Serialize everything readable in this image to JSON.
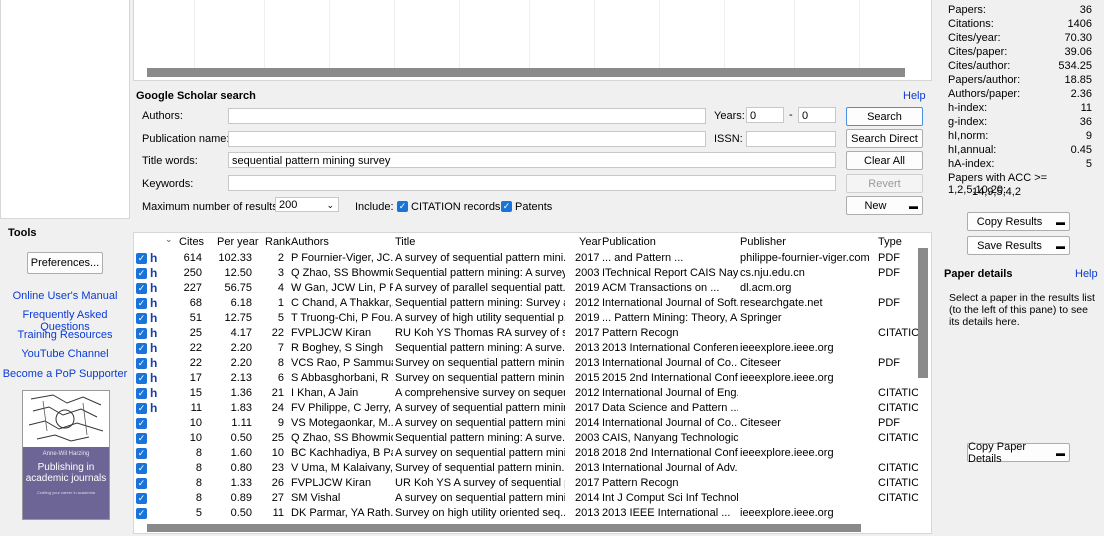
{
  "tools": {
    "title": "Tools",
    "preferences": "Preferences...",
    "links": [
      "Online User's Manual",
      "Frequently Asked Questions",
      "Training Resources",
      "YouTube Channel",
      "Become a PoP Supporter"
    ],
    "book": {
      "author": "Anne-Wil Harzing",
      "title": "Publishing in academic journals",
      "subtitle": "Crafting your career in academia"
    }
  },
  "search": {
    "title": "Google Scholar search",
    "help": "Help",
    "authors_label": "Authors:",
    "authors_value": "",
    "publication_label": "Publication name:",
    "publication_value": "",
    "title_words_label": "Title words:",
    "title_words_value": "sequential pattern mining survey",
    "keywords_label": "Keywords:",
    "keywords_value": "",
    "years_label": "Years:",
    "year_from": "0",
    "year_sep": "-",
    "year_to": "0",
    "issn_label": "ISSN:",
    "issn_value": "",
    "max_label": "Maximum number of results:",
    "max_value": "200",
    "include_label": "Include:",
    "citation_records": "CITATION records",
    "patents": "Patents",
    "buttons": {
      "search": "Search",
      "search_direct": "Search Direct",
      "clear_all": "Clear All",
      "revert": "Revert",
      "new": "New"
    }
  },
  "results": {
    "headers": [
      "Cites",
      "Per year",
      "Rank",
      "Authors",
      "Title",
      "Year",
      "Publication",
      "Publisher",
      "Type"
    ],
    "rows": [
      {
        "h": true,
        "cites": "614",
        "per_year": "102.33",
        "rank": "2",
        "authors": "P Fournier-Viger, JC...",
        "title": "A survey of sequential pattern mini...",
        "year": "2017",
        "publication": "... and Pattern ...",
        "publisher": "philippe-fournier-viger.com",
        "type": "PDF"
      },
      {
        "h": true,
        "cites": "250",
        "per_year": "12.50",
        "rank": "3",
        "authors": "Q Zhao, SS Bhowmick",
        "title": "Sequential pattern mining: A survey",
        "year": "2003",
        "publication": "ITechnical Report CAIS Nay...",
        "publisher": "cs.nju.edu.cn",
        "type": "PDF"
      },
      {
        "h": true,
        "cites": "227",
        "per_year": "56.75",
        "rank": "4",
        "authors": "W Gan, JCW Lin, P F...",
        "title": "A survey of parallel sequential patt...",
        "year": "2019",
        "publication": "ACM Transactions on ...",
        "publisher": "dl.acm.org",
        "type": ""
      },
      {
        "h": true,
        "cites": "68",
        "per_year": "6.18",
        "rank": "1",
        "authors": "C Chand, A Thakkar,...",
        "title": "Sequential pattern mining: Survey a...",
        "year": "2012",
        "publication": "International Journal of Soft...",
        "publisher": "researchgate.net",
        "type": "PDF"
      },
      {
        "h": true,
        "cites": "51",
        "per_year": "12.75",
        "rank": "5",
        "authors": "T Truong-Chi, P Fou...",
        "title": "A survey of high utility sequential p...",
        "year": "2019",
        "publication": "... Pattern Mining: Theory, A...",
        "publisher": "Springer",
        "type": ""
      },
      {
        "h": true,
        "cites": "25",
        "per_year": "4.17",
        "rank": "22",
        "authors": "FVPLJCW Kiran",
        "title": "RU Koh YS Thomas RA survey of se...",
        "year": "2017",
        "publication": "Pattern Recogn",
        "publisher": "",
        "type": "CITATION"
      },
      {
        "h": true,
        "cites": "22",
        "per_year": "2.20",
        "rank": "7",
        "authors": "R Boghey, S Singh",
        "title": "Sequential pattern mining: A surve...",
        "year": "2013",
        "publication": "2013 International Conferen...",
        "publisher": "ieeexplore.ieee.org",
        "type": ""
      },
      {
        "h": true,
        "cites": "22",
        "per_year": "2.20",
        "rank": "8",
        "authors": "VCS Rao, P Sammual",
        "title": "Survey on sequential pattern minin...",
        "year": "2013",
        "publication": "International Journal of Co...",
        "publisher": "Citeseer",
        "type": "PDF"
      },
      {
        "h": true,
        "cites": "17",
        "per_year": "2.13",
        "rank": "6",
        "authors": "S Abbasghorbani, R ...",
        "title": "Survey on sequential pattern minin...",
        "year": "2015",
        "publication": "2015 2nd International Conf...",
        "publisher": "ieeexplore.ieee.org",
        "type": ""
      },
      {
        "h": true,
        "cites": "15",
        "per_year": "1.36",
        "rank": "21",
        "authors": "I Khan, A Jain",
        "title": "A comprehensive survey on sequen...",
        "year": "2012",
        "publication": "International Journal of Eng...",
        "publisher": "",
        "type": "CITATION"
      },
      {
        "h": true,
        "cites": "11",
        "per_year": "1.83",
        "rank": "24",
        "authors": "FV Philippe, C Jerry, ...",
        "title": "A survey of sequential pattern minin...",
        "year": "2017",
        "publication": "Data Science and Pattern ...",
        "publisher": "",
        "type": "CITATION"
      },
      {
        "h": false,
        "cites": "10",
        "per_year": "1.11",
        "rank": "9",
        "authors": "VS Motegaonkar, M...",
        "title": "A survey on sequential pattern mini...",
        "year": "2014",
        "publication": "International Journal of Co...",
        "publisher": "Citeseer",
        "type": "PDF"
      },
      {
        "h": false,
        "cites": "10",
        "per_year": "0.50",
        "rank": "25",
        "authors": "Q Zhao, SS Bhowmick",
        "title": "Sequential pattern mining: A surve...",
        "year": "2003",
        "publication": "CAIS, Nanyang Technologic...",
        "publisher": "",
        "type": "CITATION"
      },
      {
        "h": false,
        "cites": "8",
        "per_year": "1.60",
        "rank": "10",
        "authors": "BC Kachhadiya, B Pa...",
        "title": "A survey on sequential pattern mini...",
        "year": "2018",
        "publication": "2018 2nd International Conf...",
        "publisher": "ieeexplore.ieee.org",
        "type": ""
      },
      {
        "h": false,
        "cites": "8",
        "per_year": "0.80",
        "rank": "23",
        "authors": "V Uma, M Kalaivany,...",
        "title": "Survey of sequential pattern minin...",
        "year": "2013",
        "publication": "International Journal of Adv...",
        "publisher": "",
        "type": "CITATION"
      },
      {
        "h": false,
        "cites": "8",
        "per_year": "1.33",
        "rank": "26",
        "authors": "FVPLJCW Kiran",
        "title": "UR Koh YS A survey of sequential p...",
        "year": "2017",
        "publication": "Pattern Recogn",
        "publisher": "",
        "type": "CITATION"
      },
      {
        "h": false,
        "cites": "8",
        "per_year": "0.89",
        "rank": "27",
        "authors": "SM Vishal",
        "title": "A survey on sequential pattern mini...",
        "year": "2014",
        "publication": "Int J Comput Sci Inf Technol",
        "publisher": "",
        "type": "CITATION"
      },
      {
        "h": false,
        "cites": "5",
        "per_year": "0.50",
        "rank": "11",
        "authors": "DK Parmar, YA Rath...",
        "title": "Survey on high utility oriented seq...",
        "year": "2013",
        "publication": "2013 IEEE International ...",
        "publisher": "ieeexplore.ieee.org",
        "type": ""
      }
    ]
  },
  "stats": [
    {
      "label": "Papers:",
      "value": "36"
    },
    {
      "label": "Citations:",
      "value": "1406"
    },
    {
      "label": "Cites/year:",
      "value": "70.30"
    },
    {
      "label": "Cites/paper:",
      "value": "39.06"
    },
    {
      "label": "Cites/author:",
      "value": "534.25"
    },
    {
      "label": "Papers/author:",
      "value": "18.85"
    },
    {
      "label": "Authors/paper:",
      "value": "2.36"
    },
    {
      "label": "h-index:",
      "value": "11"
    },
    {
      "label": "g-index:",
      "value": "36"
    },
    {
      "label": "hI,norm:",
      "value": "9"
    },
    {
      "label": "hI,annual:",
      "value": "0.45"
    },
    {
      "label": "hA-index:",
      "value": "5"
    }
  ],
  "acc": {
    "label": "Papers with ACC >= 1,2,5,10,20:",
    "value": "14,9,5,4,2"
  },
  "right": {
    "copy_results": "Copy Results",
    "save_results": "Save Results",
    "details_title": "Paper details",
    "details_help": "Help",
    "details_text": "Select a paper in the results list (to the left of this pane) to see its details here.",
    "copy_paper_details": "Copy Paper Details"
  }
}
